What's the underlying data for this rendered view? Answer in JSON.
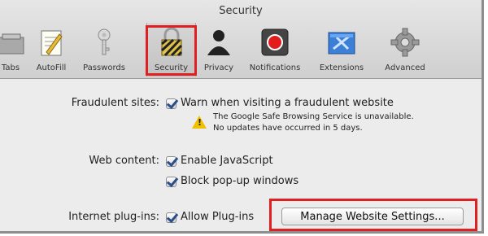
{
  "window": {
    "title": "Security"
  },
  "tabs": [
    {
      "label": "Tabs",
      "icon": "tabs-icon"
    },
    {
      "label": "AutoFill",
      "icon": "autofill-icon"
    },
    {
      "label": "Passwords",
      "icon": "key-icon"
    },
    {
      "label": "Security",
      "icon": "lock-icon",
      "selected": true
    },
    {
      "label": "Privacy",
      "icon": "privacy-icon"
    },
    {
      "label": "Notifications",
      "icon": "notifications-icon"
    },
    {
      "label": "Extensions",
      "icon": "extensions-icon"
    },
    {
      "label": "Advanced",
      "icon": "gear-icon"
    }
  ],
  "fraud": {
    "label": "Fraudulent sites:",
    "checkbox": "Warn when visiting a fraudulent website",
    "checked": true,
    "note_line1": "The Google Safe Browsing Service is unavailable.",
    "note_line2": "No updates have occurred in 5 days."
  },
  "web_content": {
    "label": "Web content:",
    "js": "Enable JavaScript",
    "js_checked": true,
    "popups": "Block pop-up windows",
    "popups_checked": true
  },
  "plugins": {
    "label": "Internet plug-ins:",
    "checkbox": "Allow Plug-ins",
    "checked": true,
    "manage_button": "Manage Website Settings..."
  },
  "colors": {
    "highlight": "#e02020",
    "checkmark": "#2a4f8a",
    "warning": "#f0c000"
  }
}
